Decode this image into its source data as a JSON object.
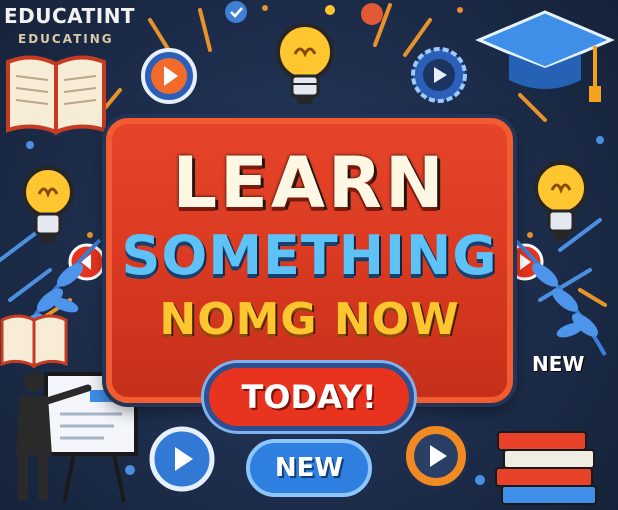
{
  "corner": {
    "top_label": "EDUCATINT",
    "sub_label": "EDUCATING"
  },
  "headline": {
    "line1": "LEARN",
    "line2": "SOMETHING",
    "line3": "NOMG NOW"
  },
  "buttons": {
    "today_label": "TODAY!",
    "new_label": "NEW"
  },
  "side_badge": "NEW",
  "colors": {
    "background": "#1b2a44",
    "panel_red": "#d6381f",
    "headline_cream": "#fdf7e3",
    "headline_blue": "#5ec2f6",
    "headline_gold": "#ffc630",
    "accent_blue": "#2f7fe0"
  },
  "icons": [
    "open-book-icon",
    "lightbulb-icon",
    "play-button-icon",
    "graduation-cap-icon",
    "presenter-icon",
    "book-stack-icon",
    "laurel-leaf-icon"
  ]
}
